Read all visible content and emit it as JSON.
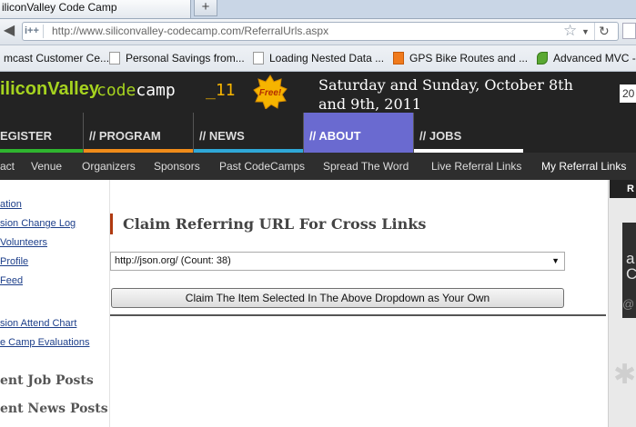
{
  "browser": {
    "tab_title": "iliconValley Code Camp",
    "new_tab_label": "+",
    "site_badge": "i++",
    "url": "http://www.siliconvalley-codecamp.com/ReferralUrls.aspx",
    "bookmarks": [
      "mcast Customer Ce...",
      "Personal Savings from...",
      "Loading Nested Data ...",
      "GPS Bike Routes and ...",
      "Advanced MVC -"
    ]
  },
  "header": {
    "logo_part1": "iliconValley",
    "logo_code": "code",
    "logo_camp": "camp",
    "logo_year": "_11",
    "free_badge": "Free!",
    "dates": "Saturday and Sunday, October 8th and 9th, 2011",
    "search_value": "20"
  },
  "main_menu": [
    {
      "label": "EGISTER",
      "color": "#2fb52f"
    },
    {
      "label": "// PROGRAM",
      "color": "#f08c1a"
    },
    {
      "label": "// NEWS",
      "color": "#2fa8d8"
    },
    {
      "label": "// ABOUT",
      "color": "#6a6ad0",
      "active": true
    },
    {
      "label": "// JOBS",
      "color": "#ffffff"
    }
  ],
  "sub_menu": [
    "act",
    "Venue",
    "Organizers",
    "Sponsors",
    "Past CodeCamps",
    "Spread The Word",
    "Live Referral Links",
    "My Referral Links"
  ],
  "sidebar": {
    "links": [
      "ation",
      "sion Change Log",
      "Volunteers",
      "Profile",
      "Feed",
      "sion Attend Chart",
      "e Camp Evaluations"
    ],
    "headings": [
      "ent Job Posts",
      "ent News Posts"
    ]
  },
  "content": {
    "title": "Claim Referring URL For Cross Links",
    "select_value": "http://json.org/ (Count: 38)",
    "claim_button": "Claim The Item Selected In The Above Dropdown as Your Own"
  },
  "right_rail": {
    "heading_letter": "R",
    "ad_letters": "a C",
    "ad_symbol": "@"
  }
}
